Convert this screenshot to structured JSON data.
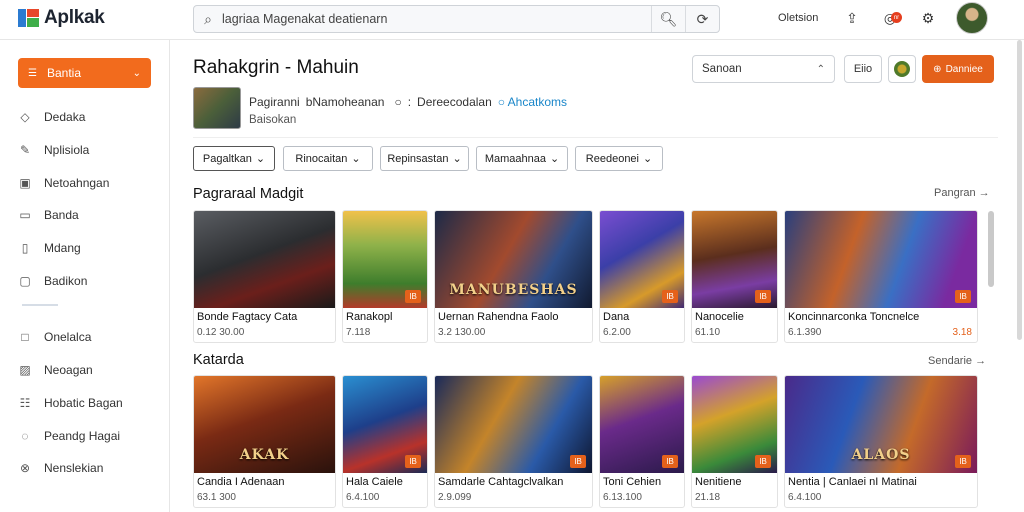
{
  "app": {
    "name": "Aplkak"
  },
  "search": {
    "placeholder": "lagriaa Magenakat deatienarn"
  },
  "topnav": {
    "label": "Oletsion",
    "notif_count": "nr"
  },
  "sidebar": {
    "active": "Bantia",
    "items": [
      {
        "label": "Dedaka",
        "icon": "diamond-icon"
      },
      {
        "label": "Nplisiola",
        "icon": "edit-icon"
      },
      {
        "label": "Netoahngan",
        "icon": "grid-icon"
      },
      {
        "label": "Banda",
        "icon": "card-icon"
      },
      {
        "label": "Mdang",
        "icon": "doc-icon"
      },
      {
        "label": "Badikon",
        "icon": "chat-icon"
      },
      {
        "label": "Onelalca",
        "icon": "box-icon"
      },
      {
        "label": "Neoagan",
        "icon": "image-icon"
      },
      {
        "label": "Hobatic Bagan",
        "icon": "list-icon"
      },
      {
        "label": "Peandg Hagai",
        "icon": "user-icon"
      },
      {
        "label": "Nenslekian",
        "icon": "x-icon"
      }
    ]
  },
  "header": {
    "title": "Rahakgrin - Mahuin",
    "sort_label": "Sanoan",
    "small_btn": "Eiio",
    "primary_btn": "Danniee"
  },
  "profile": {
    "name": "Pagiranni",
    "handle": "bNamoheanan",
    "meta": "Dereecodalan",
    "link": "Ahcatkoms",
    "sub": "Baisokan"
  },
  "filters": [
    "Pagaltkan",
    "Rinocaitan",
    "Repinsastan",
    "Mamaahnaa",
    "Reedeonei"
  ],
  "sections": [
    {
      "title": "Pagraraal Madgit",
      "more": "Pangran",
      "cards": [
        {
          "name": "Bonde Fagtacy Cata",
          "meta": "0.12 30.00",
          "tag": "",
          "extra": "",
          "stamp": ""
        },
        {
          "name": "Ranakopl",
          "meta": "7.118",
          "tag": "IB",
          "extra": "",
          "stamp": ""
        },
        {
          "name": "Uernan Rahendna Faolo",
          "meta": "3.2 130.00",
          "tag": "",
          "extra": "",
          "stamp": "MANUBESHAS"
        },
        {
          "name": "Dana",
          "meta": "6.2.00",
          "tag": "IB",
          "extra": "",
          "stamp": ""
        },
        {
          "name": "Nanocelie",
          "meta": "61.10",
          "tag": "IB",
          "extra": "",
          "stamp": ""
        },
        {
          "name": "Koncinnarconka Toncnelce",
          "meta": "6.1.390",
          "tag": "IB",
          "extra": "3.18",
          "stamp": ""
        }
      ]
    },
    {
      "title": "Katarda",
      "more": "Sendarie",
      "cards": [
        {
          "name": "Candia I Adenaan",
          "meta": "63.1 300",
          "tag": "",
          "extra": "",
          "stamp": "AKAK"
        },
        {
          "name": "Hala Caiele",
          "meta": "6.4.100",
          "tag": "IB",
          "extra": "",
          "stamp": ""
        },
        {
          "name": "Samdarle Cahtagclvalkan",
          "meta": "2.9.099",
          "tag": "IB",
          "extra": "",
          "stamp": ""
        },
        {
          "name": "Toni Cehien",
          "meta": "6.13.100",
          "tag": "IB",
          "extra": "",
          "stamp": ""
        },
        {
          "name": "Nenitiene",
          "meta": "21.18",
          "tag": "IB",
          "extra": "",
          "stamp": ""
        },
        {
          "name": "Nentia | Canlaei nI Matinai",
          "meta": "6.4.100",
          "tag": "IB",
          "extra": "",
          "stamp": "ALAOS"
        }
      ]
    }
  ],
  "colors": {
    "accent": "#f26b1d",
    "link": "#1a86c9"
  }
}
